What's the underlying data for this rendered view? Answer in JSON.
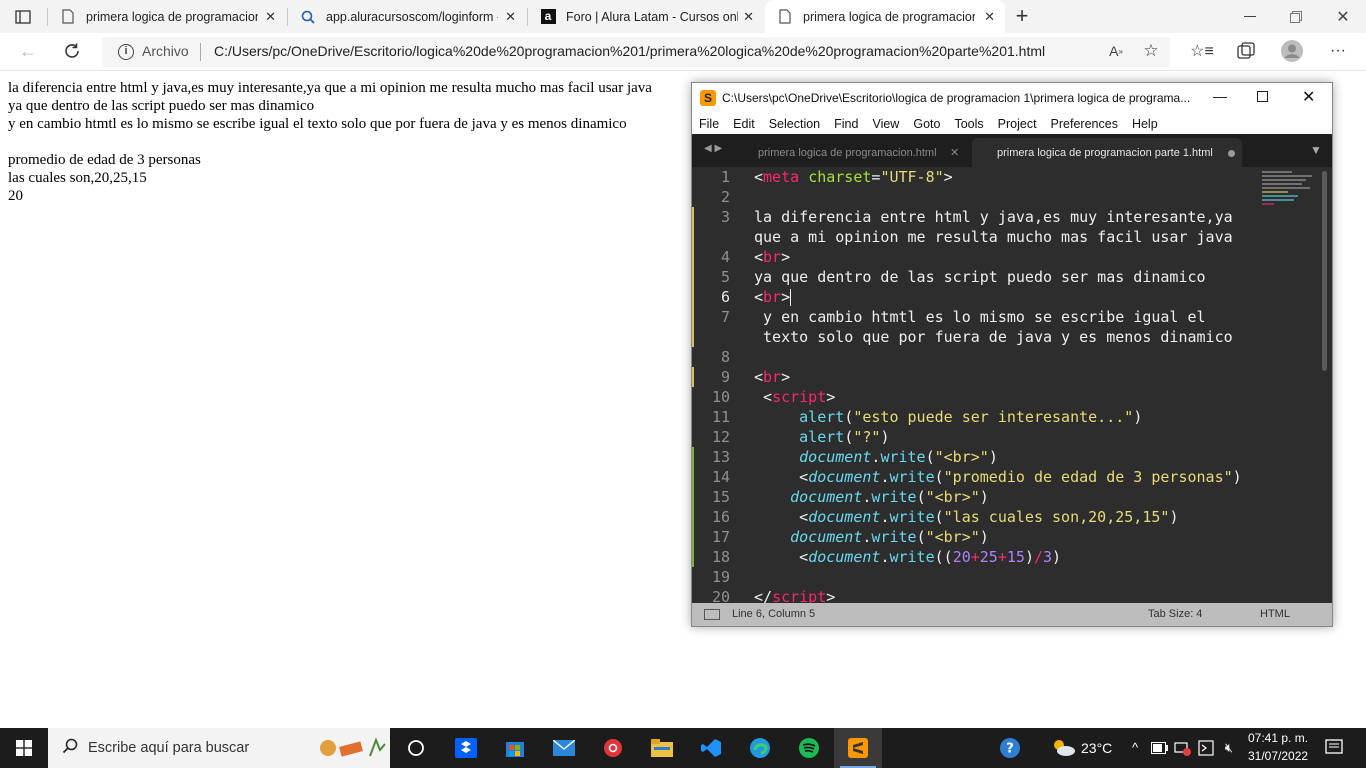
{
  "browser": {
    "tabs": [
      {
        "title": "primera logica de programacion",
        "active": false
      },
      {
        "title": "app.aluracursoscom/loginform -",
        "active": false
      },
      {
        "title": "Foro | Alura Latam - Cursos onlin",
        "active": false
      },
      {
        "title": "primera logica de programacion",
        "active": true
      }
    ],
    "new_tab": "+",
    "address_label": "Archivo",
    "url": "C:/Users/pc/OneDrive/Escritorio/logica%20de%20programacion%201/primera%20logica%20de%20programacion%20parte%201.html"
  },
  "page": {
    "lines": [
      "la diferencia entre html y java,es muy interesante,ya que a mi opinion me resulta mucho mas facil usar java",
      "ya que dentro de las script puedo ser mas dinamico",
      "y en cambio htmtl es lo mismo se escribe igual el texto solo que por fuera de java y es menos dinamico",
      "",
      "promedio de edad de 3 personas",
      "las cuales son,20,25,15",
      "20"
    ]
  },
  "sublime": {
    "title": "C:\\Users\\pc\\OneDrive\\Escritorio\\logica de programacion 1\\primera logica de programa...",
    "menu": [
      "File",
      "Edit",
      "Selection",
      "Find",
      "View",
      "Goto",
      "Tools",
      "Project",
      "Preferences",
      "Help"
    ],
    "tabs": [
      {
        "label": "primera logica de programacion.html",
        "active": false
      },
      {
        "label": "primera logica de programacion parte 1.html",
        "active": true
      }
    ],
    "line_numbers": [
      "1",
      "2",
      "3",
      "",
      "4",
      "5",
      "6",
      "7",
      "",
      "8",
      "9",
      "10",
      "11",
      "12",
      "13",
      "14",
      "15",
      "16",
      "17",
      "18",
      "19",
      "20"
    ],
    "status_position": "Line 6, Column 5",
    "tab_size": "Tab Size: 4",
    "syntax": "HTML",
    "colors": {
      "tag": "#f92672",
      "attr": "#a6e22e",
      "string": "#e6db74",
      "func": "#66d9ef",
      "number": "#ae81ff",
      "bg": "#2d2d2d"
    }
  },
  "taskbar": {
    "search_placeholder": "Escribe aquí para buscar",
    "temperature": "23°C",
    "time": "07:41 p. m.",
    "date": "31/07/2022"
  }
}
